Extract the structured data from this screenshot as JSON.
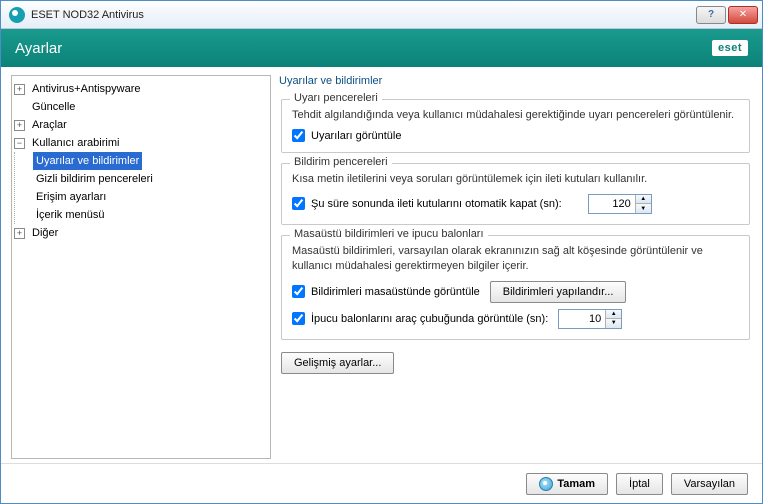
{
  "window": {
    "title": "ESET NOD32 Antivirus"
  },
  "header": {
    "title": "Ayarlar",
    "logo": "eset"
  },
  "tree": {
    "items": [
      {
        "label": "Antivirus+Antispyware",
        "expandable": true,
        "expanded": false
      },
      {
        "label": "Güncelle",
        "expandable": false
      },
      {
        "label": "Araçlar",
        "expandable": true,
        "expanded": false
      },
      {
        "label": "Kullanıcı arabirimi",
        "expandable": true,
        "expanded": true,
        "children": [
          {
            "label": "Uyarılar ve bildirimler",
            "selected": true
          },
          {
            "label": "Gizli bildirim pencereleri"
          },
          {
            "label": "Erişim ayarları"
          },
          {
            "label": "İçerik menüsü"
          }
        ]
      },
      {
        "label": "Diğer",
        "expandable": true,
        "expanded": false
      }
    ]
  },
  "main": {
    "heading": "Uyarılar ve bildirimler",
    "group1": {
      "legend": "Uyarı pencereleri",
      "desc": "Tehdit algılandığında veya kullanıcı müdahalesi gerektiğinde uyarı pencereleri görüntülenir.",
      "chk_label": "Uyarıları görüntüle",
      "chk_checked": true
    },
    "group2": {
      "legend": "Bildirim pencereleri",
      "desc": "Kısa metin iletilerini veya soruları görüntülemek için ileti kutuları kullanılır.",
      "chk_label": "Şu süre sonunda ileti kutularını otomatik kapat (sn):",
      "chk_checked": true,
      "value": "120"
    },
    "group3": {
      "legend": "Masaüstü bildirimleri ve ipucu balonları",
      "desc": "Masaüstü bildirimleri, varsayılan olarak ekranınızın sağ alt köşesinde görüntülenir ve kullanıcı müdahalesi gerektirmeyen bilgiler içerir.",
      "chk1_label": "Bildirimleri masaüstünde görüntüle",
      "chk1_checked": true,
      "btn_config": "Bildirimleri yapılandır...",
      "chk2_label": "İpucu balonlarını araç çubuğunda görüntüle (sn):",
      "chk2_checked": true,
      "value": "10"
    },
    "advanced_btn": "Gelişmiş ayarlar..."
  },
  "footer": {
    "ok": "Tamam",
    "cancel": "İptal",
    "defaults": "Varsayılan"
  }
}
